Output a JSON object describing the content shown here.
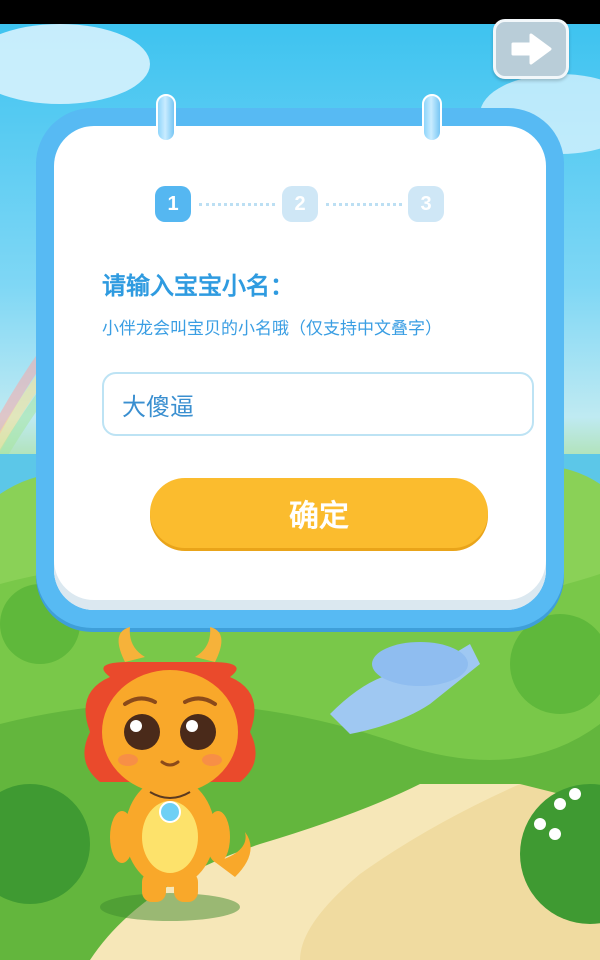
{
  "header": {
    "back_button_icon": "arrow-right-icon"
  },
  "steps": {
    "items": [
      "1",
      "2",
      "3"
    ],
    "current": 1
  },
  "form": {
    "prompt": "请输入宝宝小名：",
    "hint": "小伴龙会叫宝贝的小名哦（仅支持中文叠字）",
    "nickname_value": "大傻逼",
    "confirm_label": "确定"
  },
  "scene": {
    "mascot": "dragon-mascot",
    "colors": {
      "card_border": "#57baf3",
      "confirm_button": "#fbbc2e",
      "prompt_text": "#2f9be0"
    }
  }
}
